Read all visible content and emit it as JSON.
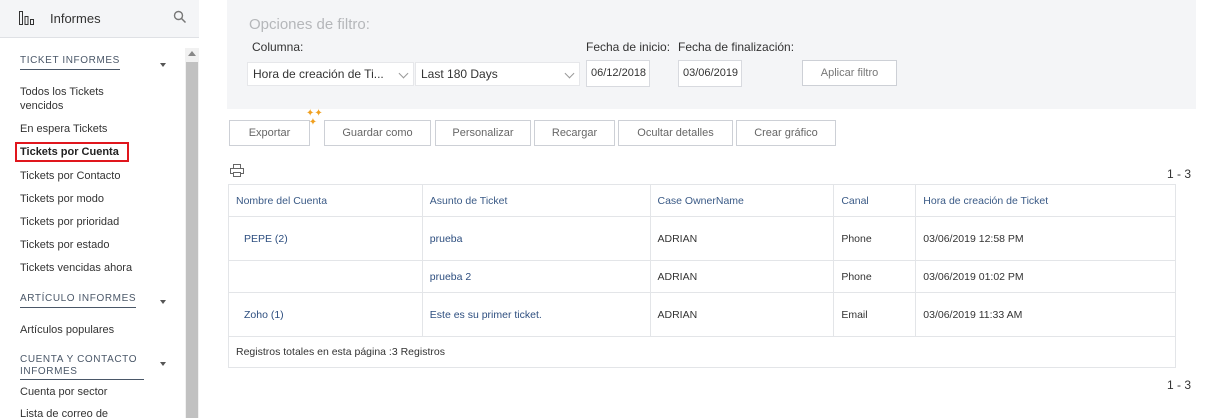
{
  "sidebar": {
    "title": "Informes",
    "sections": [
      {
        "title": "TICKET INFORMES"
      },
      {
        "title": "ARTÍCULO INFORMES"
      },
      {
        "title_line1": "CUENTA Y CONTACTO",
        "title_line2": "INFORMES"
      }
    ],
    "ticket_items": [
      "Todos los Tickets",
      "vencidos",
      "En espera Tickets",
      "Tickets por Cuenta",
      "Tickets por Contacto",
      "Tickets por modo",
      "Tickets por prioridad",
      "Tickets por estado",
      "Tickets vencidas ahora"
    ],
    "article_items": [
      "Artículos populares"
    ],
    "account_items": [
      "Cuenta por sector",
      "Lista de correo de"
    ]
  },
  "filter": {
    "title": "Opciones de filtro:",
    "column_label": "Columna:",
    "column_value": "Hora de creación de Ti...",
    "period_value": "Last 180 Days",
    "start_label": "Fecha de inicio:",
    "end_label": "Fecha de finalización:",
    "start_value": "06/12/2018",
    "end_value": "03/06/2019",
    "apply_label": "Aplicar filtro"
  },
  "toolbar": {
    "export": "Exportar",
    "save_as": "Guardar como",
    "customize": "Personalizar",
    "reload": "Recargar",
    "hide_details": "Ocultar detalles",
    "create_chart": "Crear gráfico"
  },
  "pager": {
    "top": "1 - 3",
    "bottom": "1 - 3"
  },
  "table": {
    "headers": [
      "Nombre del Cuenta",
      "Asunto de Ticket",
      "Case OwnerName",
      "Canal",
      "Hora de creación de Ticket"
    ],
    "rows": [
      [
        "PEPE (2)",
        "prueba",
        "ADRIAN",
        "Phone",
        "03/06/2019 12:58 PM"
      ],
      [
        "",
        "prueba 2",
        "ADRIAN",
        "Phone",
        "03/06/2019 01:02 PM"
      ],
      [
        "Zoho (1)",
        "Este es su primer ticket.",
        "ADRIAN",
        "Email",
        "03/06/2019 11:33 AM"
      ]
    ],
    "total": "Registros totales en esta página :3 Registros"
  },
  "icons": {
    "logo": "bar-chart-icon",
    "search": "search-icon",
    "print": "printer-icon"
  }
}
